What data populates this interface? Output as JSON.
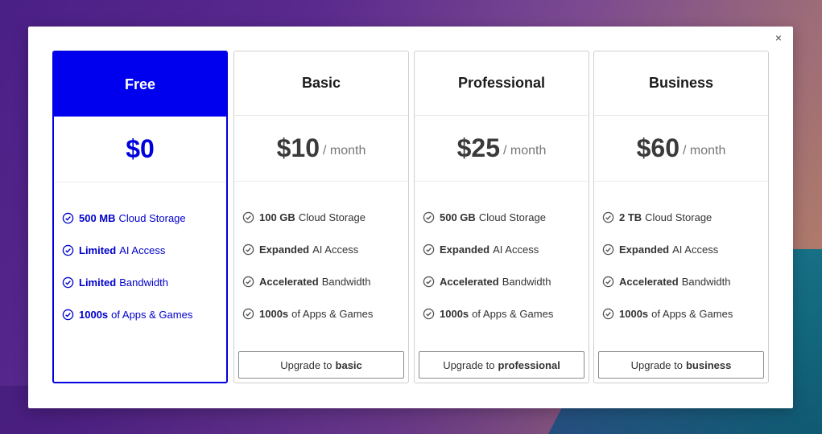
{
  "modal": {
    "close_label": "×"
  },
  "plans": [
    {
      "id": "free",
      "name": "Free",
      "price": "$0",
      "period": "",
      "features": [
        {
          "bold": "500 MB",
          "text": "Cloud Storage"
        },
        {
          "bold": "Limited",
          "text": "AI Access"
        },
        {
          "bold": "Limited",
          "text": "Bandwidth"
        },
        {
          "bold": "1000s",
          "text": "of Apps & Games"
        }
      ],
      "upgrade_prefix": "",
      "upgrade_plan": ""
    },
    {
      "id": "basic",
      "name": "Basic",
      "price": "$10",
      "period": "/ month",
      "features": [
        {
          "bold": "100 GB",
          "text": "Cloud Storage"
        },
        {
          "bold": "Expanded",
          "text": "AI Access"
        },
        {
          "bold": "Accelerated",
          "text": "Bandwidth"
        },
        {
          "bold": "1000s",
          "text": "of Apps & Games"
        }
      ],
      "upgrade_prefix": "Upgrade to",
      "upgrade_plan": "basic"
    },
    {
      "id": "professional",
      "name": "Professional",
      "price": "$25",
      "period": "/ month",
      "features": [
        {
          "bold": "500 GB",
          "text": "Cloud Storage"
        },
        {
          "bold": "Expanded",
          "text": "AI Access"
        },
        {
          "bold": "Accelerated",
          "text": "Bandwidth"
        },
        {
          "bold": "1000s",
          "text": "of Apps & Games"
        }
      ],
      "upgrade_prefix": "Upgrade to",
      "upgrade_plan": "professional"
    },
    {
      "id": "business",
      "name": "Business",
      "price": "$60",
      "period": "/ month",
      "features": [
        {
          "bold": "2 TB",
          "text": "Cloud Storage"
        },
        {
          "bold": "Expanded",
          "text": "AI Access"
        },
        {
          "bold": "Accelerated",
          "text": "Bandwidth"
        },
        {
          "bold": "1000s",
          "text": "of Apps & Games"
        }
      ],
      "upgrade_prefix": "Upgrade to",
      "upgrade_plan": "business"
    }
  ],
  "colors": {
    "accent": "#0000ee",
    "check": "#555555"
  },
  "icons": {
    "close": "close-icon",
    "check": "check-circle-icon"
  }
}
